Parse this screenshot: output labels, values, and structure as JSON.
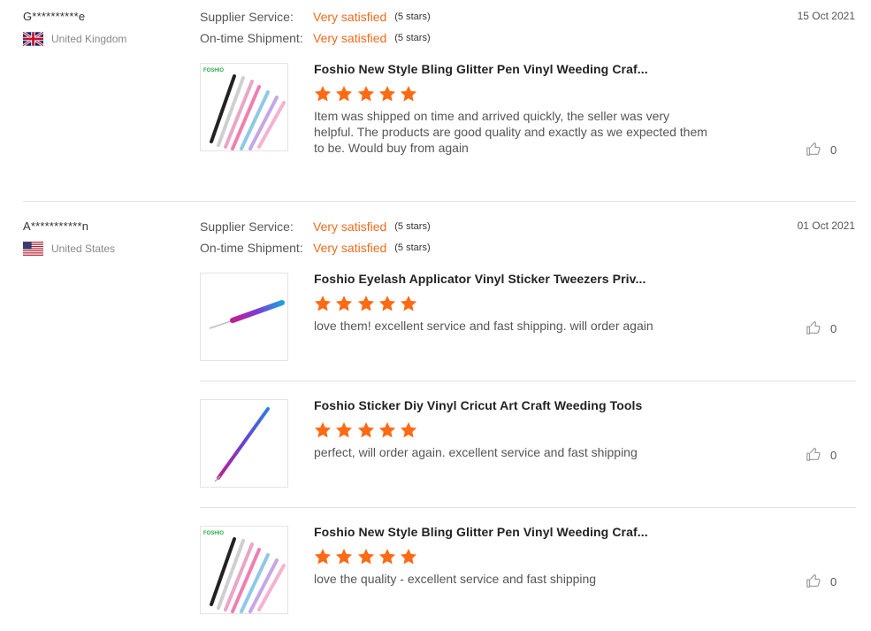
{
  "reviews": [
    {
      "user": "G**********e",
      "country": "United Kingdom",
      "flag": "uk-flag-icon",
      "date": "15 Oct 2021",
      "supplier_label": "Supplier Service:",
      "supplier_value": "Very satisfied",
      "supplier_stars": "(5 stars)",
      "shipment_label": "On-time Shipment:",
      "shipment_value": "Very satisfied",
      "shipment_stars": "(5 stars)",
      "items": [
        {
          "title": "Foshio New Style Bling Glitter Pen Vinyl Weeding Craf...",
          "rating": 5,
          "comment": "Item was shipped on time and arrived quickly, the seller was very helpful. The products are good quality and exactly as we expected them to be. Would buy from again",
          "likes": "0",
          "brand": "FOSHIO"
        }
      ]
    },
    {
      "user": "A***********n",
      "country": "United States",
      "flag": "us-flag-icon",
      "date": "01 Oct 2021",
      "supplier_label": "Supplier Service:",
      "supplier_value": "Very satisfied",
      "supplier_stars": "(5 stars)",
      "shipment_label": "On-time Shipment:",
      "shipment_value": "Very satisfied",
      "shipment_stars": "(5 stars)",
      "items": [
        {
          "title": "Foshio Eyelash Applicator Vinyl Sticker Tweezers Priv...",
          "rating": 5,
          "comment": "love them! excellent service and fast shipping. will order again",
          "likes": "0"
        },
        {
          "title": "Foshio Sticker Diy Vinyl Cricut Art Craft Weeding Tools",
          "rating": 5,
          "comment": "perfect, will order again. excellent service and fast shipping",
          "likes": "0"
        },
        {
          "title": "Foshio New Style Bling Glitter Pen Vinyl Weeding Craf...",
          "rating": 5,
          "comment": "love the quality - excellent service and fast shipping",
          "likes": "0",
          "brand": "FOSHIO"
        }
      ]
    }
  ],
  "colors": {
    "accent": "#f06b1e",
    "star": "#ff6a14",
    "divider": "#e3e3e3"
  }
}
